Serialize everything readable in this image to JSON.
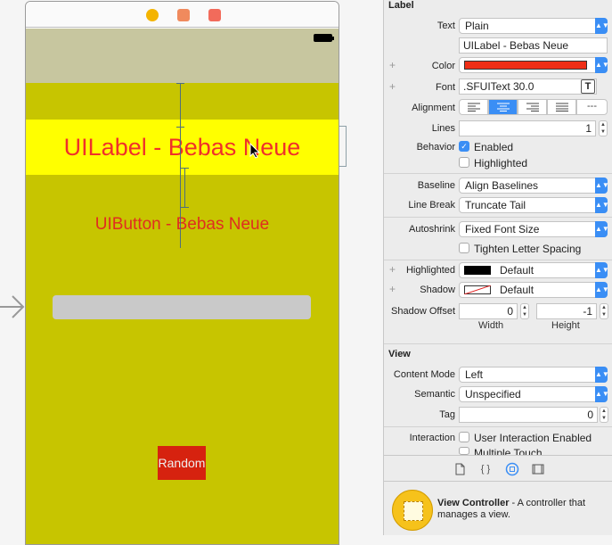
{
  "canvas": {
    "label_text": "UILabel - Bebas Neue",
    "button_text": "UIButton - Bebas Neue",
    "random_button_label": "Random"
  },
  "inspector": {
    "label_section": {
      "title": "Label",
      "text_label": "Text",
      "text_type": "Plain",
      "text_value": "UILabel - Bebas Neue",
      "color_label": "Color",
      "color_value": "#ef2f17",
      "font_label": "Font",
      "font_value": ".SFUIText 30.0",
      "alignment_label": "Alignment",
      "alignment_options": [
        "left",
        "center",
        "right",
        "justified",
        "natural"
      ],
      "alignment_selected": "center",
      "natural_glyph": "---",
      "lines_label": "Lines",
      "lines_value": "1",
      "behavior_label": "Behavior",
      "enabled_label": "Enabled",
      "enabled_checked": true,
      "highlighted_checkbox_label": "Highlighted",
      "highlighted_checked": false,
      "baseline_label": "Baseline",
      "baseline_value": "Align Baselines",
      "line_break_label": "Line Break",
      "line_break_value": "Truncate Tail",
      "autoshrink_label": "Autoshrink",
      "autoshrink_value": "Fixed Font Size",
      "tighten_label": "Tighten Letter Spacing",
      "tighten_checked": false,
      "highlighted_color_label": "Highlighted",
      "highlighted_color_value": "Default",
      "shadow_label": "Shadow",
      "shadow_value": "Default",
      "shadow_offset_label": "Shadow Offset",
      "shadow_width_value": "0",
      "shadow_height_value": "-1",
      "width_label": "Width",
      "height_label": "Height"
    },
    "view_section": {
      "title": "View",
      "content_mode_label": "Content Mode",
      "content_mode_value": "Left",
      "semantic_label": "Semantic",
      "semantic_value": "Unspecified",
      "tag_label": "Tag",
      "tag_value": "0",
      "interaction_label": "Interaction",
      "user_interaction_label": "User Interaction Enabled",
      "user_interaction_checked": false,
      "multiple_touch_label": "Multiple Touch"
    },
    "library": {
      "tabs": [
        "file-icon",
        "braces-icon",
        "object-icon",
        "media-icon"
      ],
      "selected_tab": "object-icon",
      "item_title": "View Controller",
      "item_description": " - A controller that manages a view."
    }
  }
}
